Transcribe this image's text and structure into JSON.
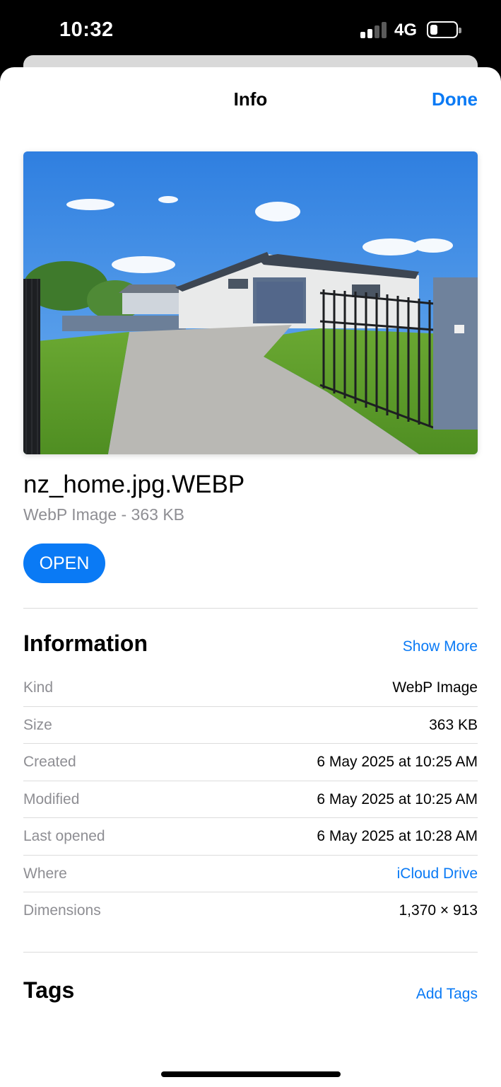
{
  "status_bar": {
    "time": "10:32",
    "network": "4G",
    "signal_bars_filled": 2,
    "signal_bars_total": 4,
    "battery_level": 0.3
  },
  "sheet": {
    "title": "Info",
    "done_label": "Done"
  },
  "file": {
    "name": "nz_home.jpg.WEBP",
    "subtitle": "WebP Image - 363 KB",
    "open_label": "OPEN"
  },
  "information": {
    "title": "Information",
    "show_more_label": "Show More",
    "rows": [
      {
        "label": "Kind",
        "value": "WebP Image"
      },
      {
        "label": "Size",
        "value": "363 KB"
      },
      {
        "label": "Created",
        "value": "6 May 2025 at 10:25 AM"
      },
      {
        "label": "Modified",
        "value": "6 May 2025 at 10:25 AM"
      },
      {
        "label": "Last opened",
        "value": "6 May 2025 at 10:28 AM"
      },
      {
        "label": "Where",
        "value": "iCloud Drive"
      },
      {
        "label": "Dimensions",
        "value": "1,370 × 913"
      }
    ]
  },
  "tags": {
    "title": "Tags",
    "add_label": "Add Tags"
  },
  "colors": {
    "accent": "#0a7af5",
    "secondary_text": "#8e8e93"
  }
}
